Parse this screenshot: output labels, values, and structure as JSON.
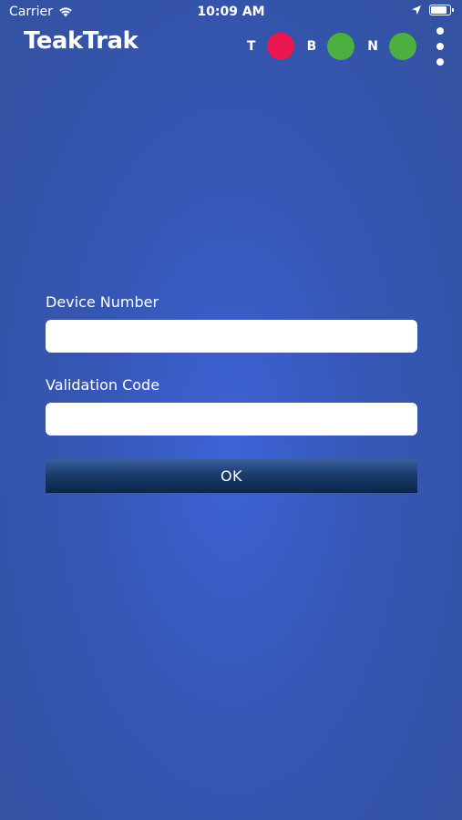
{
  "status_bar": {
    "carrier": "Carrier",
    "time": "10:09 AM",
    "wifi_icon": "wifi-icon",
    "location_icon": "location-arrow-icon",
    "battery_icon": "battery-icon",
    "battery_level": 0.9
  },
  "header": {
    "title": "TeakTrak",
    "indicators": [
      {
        "label": "T",
        "color": "#e8174f"
      },
      {
        "label": "B",
        "color": "#4caf3f"
      },
      {
        "label": "N",
        "color": "#4caf3f"
      }
    ],
    "menu_icon": "more-vertical-icon"
  },
  "form": {
    "device_number_label": "Device Number",
    "device_number_value": "",
    "validation_code_label": "Validation Code",
    "validation_code_value": "",
    "ok_label": "OK"
  },
  "colors": {
    "ok_button": "#0b2548",
    "background": "#3656b4"
  }
}
